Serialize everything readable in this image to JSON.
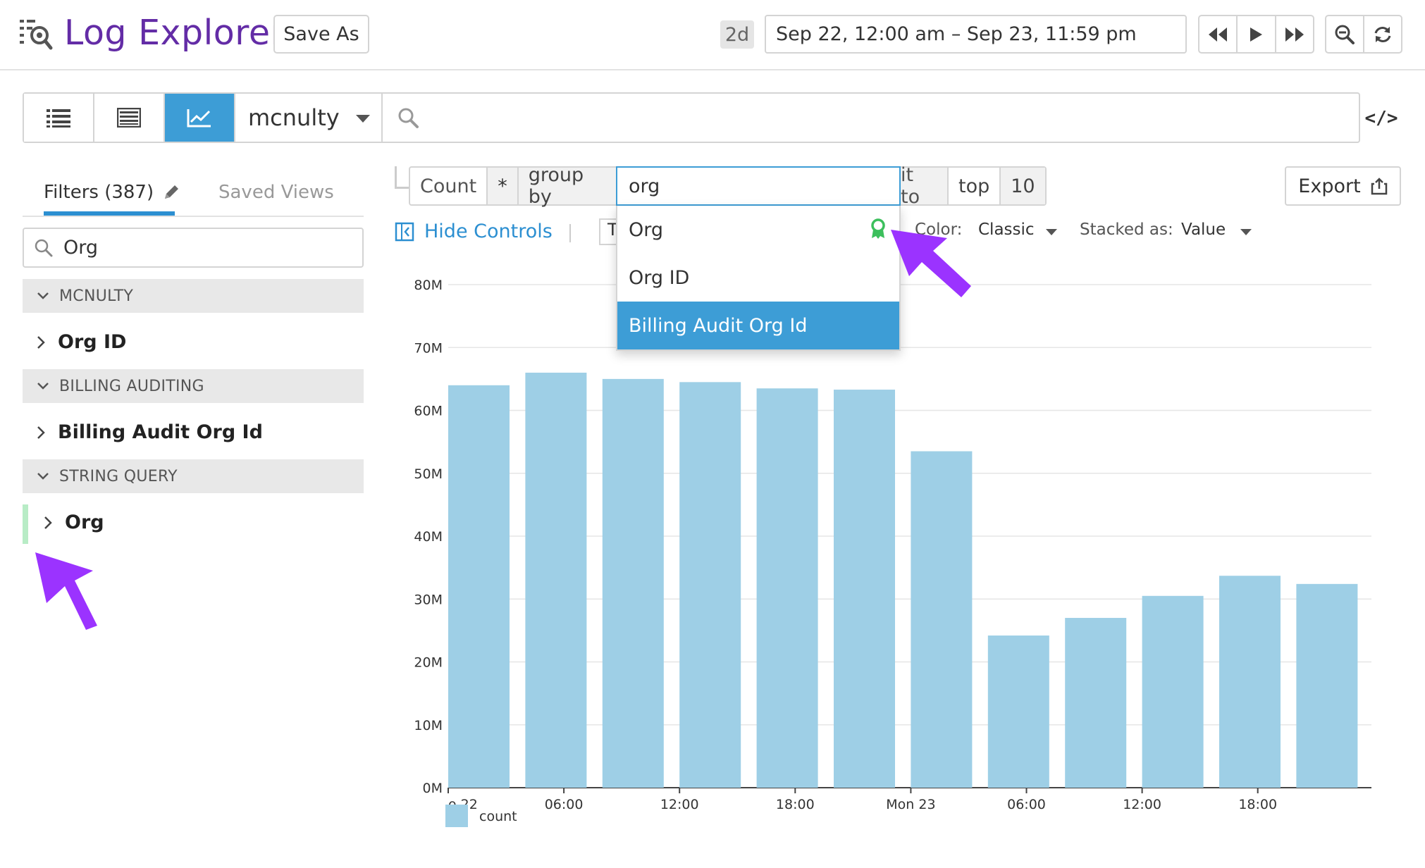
{
  "header": {
    "title": "Log Explorer",
    "save_as": "Save As",
    "range_badge": "2d",
    "time_range": "Sep 22, 12:00 am – Sep 23, 11:59 pm"
  },
  "search": {
    "index": "mcnulty",
    "code_toggle": "</>"
  },
  "sidebar": {
    "tab_filters": "Filters (387)",
    "tab_saved": "Saved Views",
    "facet_search": "Org",
    "groups": [
      {
        "title": "MCNULTY",
        "facet": "Org ID"
      },
      {
        "title": "BILLING AUDITING",
        "facet": "Billing Audit Org Id"
      },
      {
        "title": "STRING QUERY",
        "facet": "Org"
      }
    ]
  },
  "controls": {
    "measure": "Count",
    "star": "*",
    "group_by": "group by",
    "group_by_value": "org",
    "limit_to": "it to",
    "top": "top",
    "limit": "10",
    "export": "Export",
    "hide_controls": "Hide Controls",
    "timeseries_stub": "T",
    "color_label": "Color:",
    "color_value": "Classic",
    "stacked_label": "Stacked as:",
    "stacked_value": "Value"
  },
  "suggestions": [
    {
      "label": "Org",
      "selected": false
    },
    {
      "label": "Org ID",
      "selected": false
    },
    {
      "label": "Billing Audit Org Id",
      "selected": true
    }
  ],
  "colors": {
    "accent": "#3d9dd6",
    "brand": "#632ca6",
    "bar": "#9ecfe6",
    "arrow": "#9b33ff",
    "badge": "#3cbf5c"
  },
  "chart_data": {
    "type": "bar",
    "categories": [
      "1",
      "2",
      "3",
      "4",
      "5",
      "6",
      "7",
      "8",
      "9",
      "10",
      "11",
      "12"
    ],
    "values": [
      64,
      66,
      65,
      64.5,
      63.5,
      63.3,
      53.5,
      24.2,
      27,
      30.5,
      33.7,
      32.4
    ],
    "ylim": [
      0,
      80
    ],
    "y_ticks": [
      "0M",
      "10M",
      "20M",
      "30M",
      "40M",
      "50M",
      "60M",
      "70M",
      "80M"
    ],
    "x_ticks": [
      {
        "label": "o 22",
        "at": 0
      },
      {
        "label": "06:00",
        "at": 1.5
      },
      {
        "label": "12:00",
        "at": 3
      },
      {
        "label": "18:00",
        "at": 4.5
      },
      {
        "label": "Mon 23",
        "at": 6
      },
      {
        "label": "06:00",
        "at": 7.5
      },
      {
        "label": "12:00",
        "at": 9
      },
      {
        "label": "18:00",
        "at": 10.5
      }
    ],
    "legend": [
      {
        "name": "count"
      }
    ],
    "grid": true
  }
}
